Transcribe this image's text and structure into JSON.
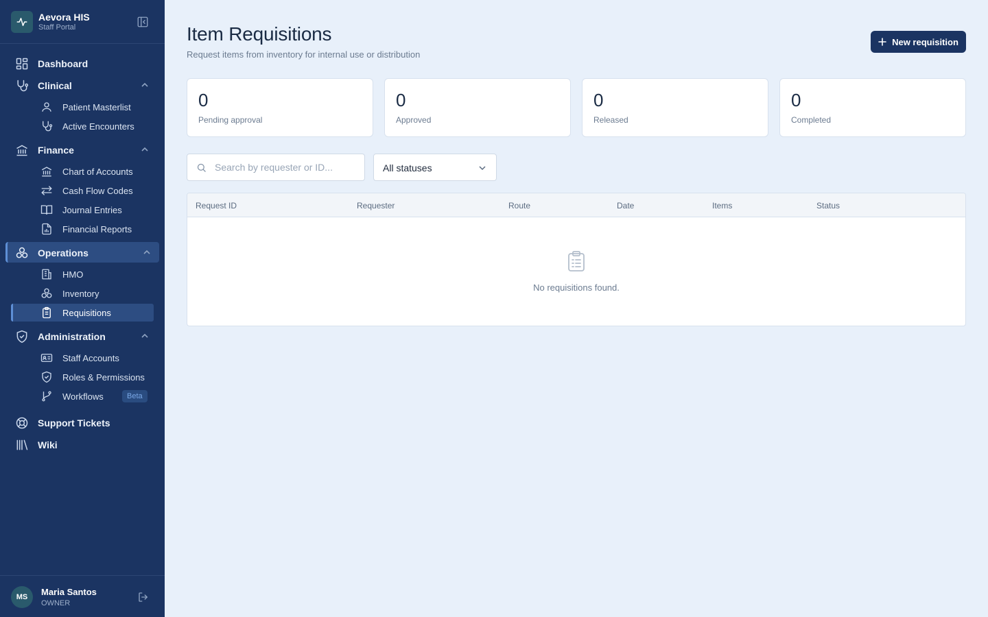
{
  "brand": {
    "title": "Aevora HIS",
    "subtitle": "Staff Portal"
  },
  "nav": {
    "dashboard": "Dashboard",
    "clinical": {
      "label": "Clinical",
      "items": [
        "Patient Masterlist",
        "Active Encounters"
      ]
    },
    "finance": {
      "label": "Finance",
      "items": [
        "Chart of Accounts",
        "Cash Flow Codes",
        "Journal Entries",
        "Financial Reports"
      ]
    },
    "operations": {
      "label": "Operations",
      "items": [
        "HMO",
        "Inventory",
        "Requisitions"
      ]
    },
    "administration": {
      "label": "Administration",
      "items": [
        "Staff Accounts",
        "Roles & Permissions",
        "Workflows"
      ],
      "workflows_badge": "Beta"
    },
    "support": "Support Tickets",
    "wiki": "Wiki"
  },
  "user": {
    "initials": "MS",
    "name": "Maria Santos",
    "role": "OWNER"
  },
  "page": {
    "title": "Item Requisitions",
    "subtitle": "Request items from inventory for internal use or distribution",
    "new_button": "New requisition"
  },
  "stats": [
    {
      "value": "0",
      "label": "Pending approval"
    },
    {
      "value": "0",
      "label": "Approved"
    },
    {
      "value": "0",
      "label": "Released"
    },
    {
      "value": "0",
      "label": "Completed"
    }
  ],
  "filters": {
    "search_placeholder": "Search by requester or ID...",
    "status_value": "All statuses"
  },
  "table": {
    "columns": [
      "Request ID",
      "Requester",
      "Route",
      "Date",
      "Items",
      "Status"
    ],
    "empty_text": "No requisitions found."
  },
  "colors": {
    "sidebar": "#1b3462",
    "accent": "#5e8fd6",
    "background": "#e8f0fa",
    "primary_button": "#1b3462"
  }
}
